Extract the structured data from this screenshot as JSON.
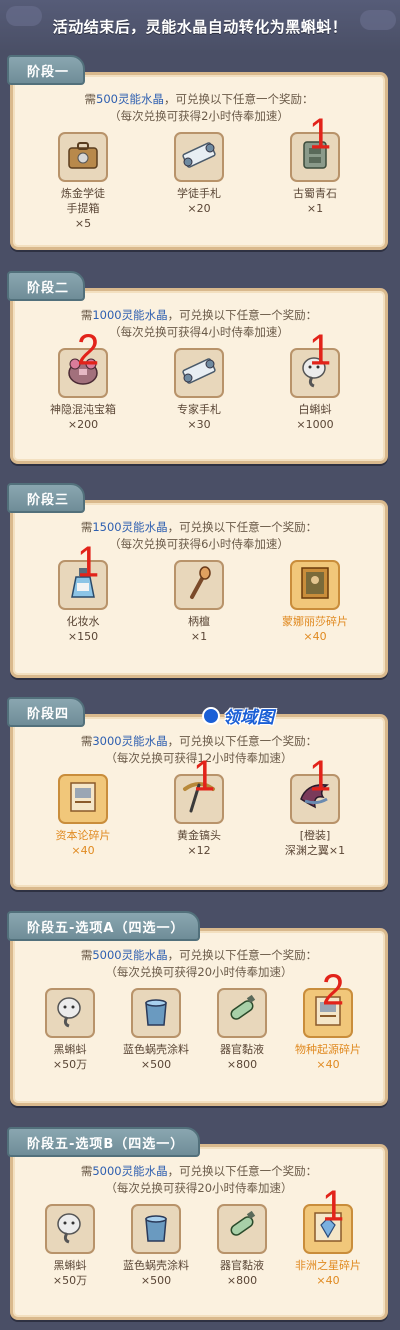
{
  "banner": {
    "text": "活动结束后，灵能水晶自动转化为黑蝌蚪！"
  },
  "watermark": {
    "text": "领域图"
  },
  "stages": [
    {
      "title": "阶段一",
      "req_prefix": "需",
      "req_amount": "500灵能水晶",
      "req_suffix": "，可兑换以下任意一个奖励：",
      "note": "（每次兑换可获得2小时侍奉加速）",
      "items": [
        {
          "name": "炼金学徒",
          "name2": "手提箱",
          "qty": "×5",
          "icon": "briefcase-icon",
          "gold": false,
          "mark": ""
        },
        {
          "name": "学徒手札",
          "qty": "×20",
          "icon": "scroll-icon",
          "gold": false,
          "mark": ""
        },
        {
          "name": "古蜀青石",
          "qty": "×1",
          "icon": "stone-icon",
          "gold": false,
          "mark": "1"
        }
      ]
    },
    {
      "title": "阶段二",
      "req_prefix": "需",
      "req_amount": "1000灵能水晶",
      "req_suffix": "，可兑换以下任意一个奖励：",
      "note": "（每次兑换可获得4小时侍奉加速）",
      "items": [
        {
          "name": "神隐混沌宝箱",
          "qty": "×200",
          "icon": "chest-icon",
          "gold": false,
          "mark": "2"
        },
        {
          "name": "专家手札",
          "qty": "×30",
          "icon": "scroll-icon",
          "gold": false,
          "mark": ""
        },
        {
          "name": "白蝌蚪",
          "qty": "×1000",
          "icon": "tadpole-icon",
          "gold": false,
          "mark": "1"
        }
      ]
    },
    {
      "title": "阶段三",
      "req_prefix": "需",
      "req_amount": "1500灵能水晶",
      "req_suffix": "，可兑换以下任意一个奖励：",
      "note": "（每次兑换可获得6小时侍奉加速）",
      "items": [
        {
          "name": "化妆水",
          "qty": "×150",
          "icon": "potion-icon",
          "gold": false,
          "mark": "1"
        },
        {
          "name": "柄檀",
          "qty": "×1",
          "icon": "torch-icon",
          "gold": false,
          "mark": ""
        },
        {
          "name": "蒙娜丽莎碎片",
          "qty": "×40",
          "icon": "painting-icon",
          "gold": true,
          "mark": ""
        }
      ]
    },
    {
      "title": "阶段四",
      "req_prefix": "需",
      "req_amount": "3000灵能水晶",
      "req_suffix": "，可兑换以下任意一个奖励：",
      "note": "（每次兑换可获得12小时侍奉加速）",
      "items": [
        {
          "name": "资本论碎片",
          "qty": "×40",
          "icon": "book-icon",
          "gold": true,
          "mark": ""
        },
        {
          "name": "黄金镐头",
          "qty": "×12",
          "icon": "pickaxe-icon",
          "gold": false,
          "mark": "1"
        },
        {
          "name": "[橙装]",
          "name2": "深渊之翼×1",
          "qty": "",
          "icon": "wing-icon",
          "gold": false,
          "mark": "1"
        }
      ]
    },
    {
      "title": "阶段五-选项A（四选一）",
      "req_prefix": "需",
      "req_amount": "5000灵能水晶",
      "req_suffix": "，可兑换以下任意一个奖励：",
      "note": "（每次兑换可获得20小时侍奉加速）",
      "items": [
        {
          "name": "黑蝌蚪",
          "qty": "×50万",
          "icon": "tadpole-icon",
          "gold": false,
          "mark": ""
        },
        {
          "name": "蓝色蜗壳涂料",
          "qty": "×500",
          "icon": "paint-bucket-icon",
          "gold": false,
          "mark": ""
        },
        {
          "name": "器官黏液",
          "qty": "×800",
          "icon": "vial-icon",
          "gold": false,
          "mark": ""
        },
        {
          "name": "物种起源碎片",
          "qty": "×40",
          "icon": "book-icon",
          "gold": true,
          "mark": "2"
        }
      ]
    },
    {
      "title": "阶段五-选项B（四选一）",
      "req_prefix": "需",
      "req_amount": "5000灵能水晶",
      "req_suffix": "，可兑换以下任意一个奖励：",
      "note": "（每次兑换可获得20小时侍奉加速）",
      "items": [
        {
          "name": "黑蝌蚪",
          "qty": "×50万",
          "icon": "tadpole-icon",
          "gold": false,
          "mark": ""
        },
        {
          "name": "蓝色蜗壳涂料",
          "qty": "×500",
          "icon": "paint-bucket-icon",
          "gold": false,
          "mark": ""
        },
        {
          "name": "器官黏液",
          "qty": "×800",
          "icon": "vial-icon",
          "gold": false,
          "mark": ""
        },
        {
          "name": "非洲之星碎片",
          "qty": "×40",
          "icon": "gem-icon",
          "gold": true,
          "mark": "1"
        }
      ]
    }
  ]
}
